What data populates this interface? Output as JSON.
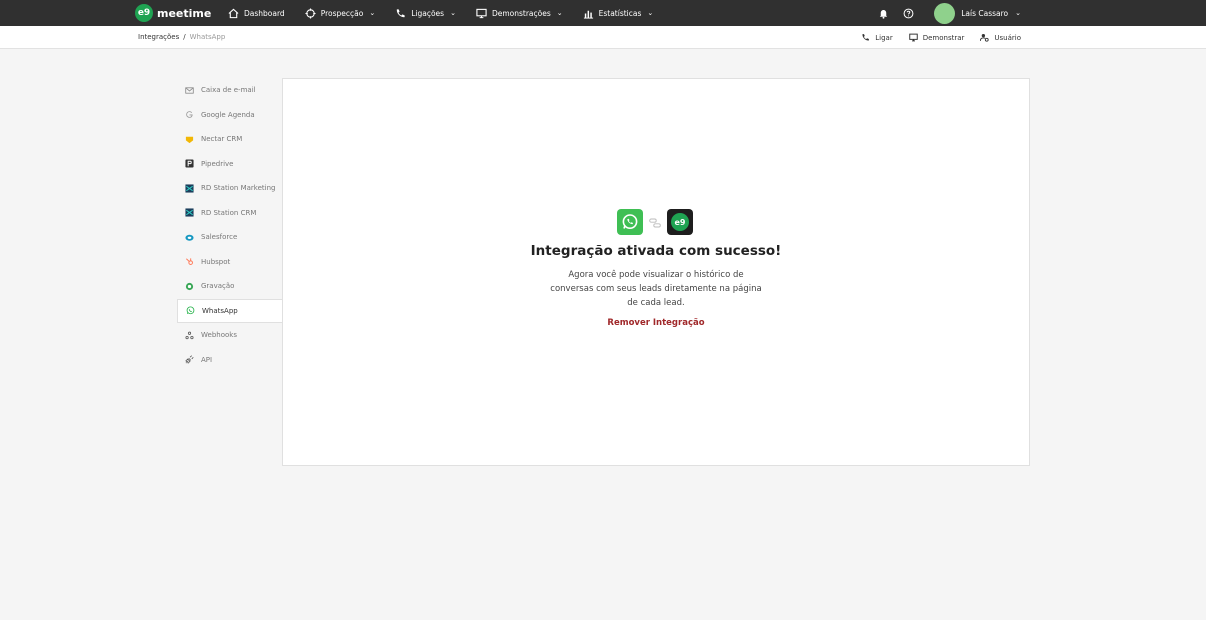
{
  "app": {
    "logo_badge": "e9",
    "name": "meetime"
  },
  "nav": {
    "items": [
      {
        "label": "Dashboard",
        "has_dropdown": false
      },
      {
        "label": "Prospecção",
        "has_dropdown": true
      },
      {
        "label": "Ligações",
        "has_dropdown": true
      },
      {
        "label": "Demonstrações",
        "has_dropdown": true
      },
      {
        "label": "Estatísticas",
        "has_dropdown": true
      }
    ],
    "user_name": "Laís Cassaro",
    "chevron": "⌄"
  },
  "breadcrumb": {
    "root": "Integrações",
    "separator": "/",
    "current": "WhatsApp"
  },
  "sub_actions": {
    "call": "Ligar",
    "demo": "Demonstrar",
    "user": "Usuário"
  },
  "sidebar": {
    "items": [
      {
        "label": "Caixa de e-mail",
        "icon": "envelope-icon"
      },
      {
        "label": "Google Agenda",
        "icon": "google-icon"
      },
      {
        "label": "Nectar CRM",
        "icon": "nectar-icon"
      },
      {
        "label": "Pipedrive",
        "icon": "pipedrive-icon"
      },
      {
        "label": "RD Station Marketing",
        "icon": "rd-station-icon"
      },
      {
        "label": "RD Station CRM",
        "icon": "rd-station-icon"
      },
      {
        "label": "Salesforce",
        "icon": "salesforce-icon"
      },
      {
        "label": "Hubspot",
        "icon": "hubspot-icon"
      },
      {
        "label": "Gravação",
        "icon": "recording-icon"
      },
      {
        "label": "WhatsApp",
        "icon": "whatsapp-icon",
        "active": true
      },
      {
        "label": "Webhooks",
        "icon": "webhooks-icon"
      },
      {
        "label": "API",
        "icon": "api-icon"
      }
    ]
  },
  "main": {
    "logo_badge": "e9",
    "title": "Integração ativada com sucesso!",
    "description": "Agora você pode visualizar o histórico de conversas com seus leads diretamente na página de cada lead.",
    "remove_label": "Remover Integração"
  },
  "colors": {
    "topbar": "#303030",
    "brand_green": "#1fa352",
    "whatsapp_green": "#3fbf54",
    "remove_red": "#a0282a"
  }
}
